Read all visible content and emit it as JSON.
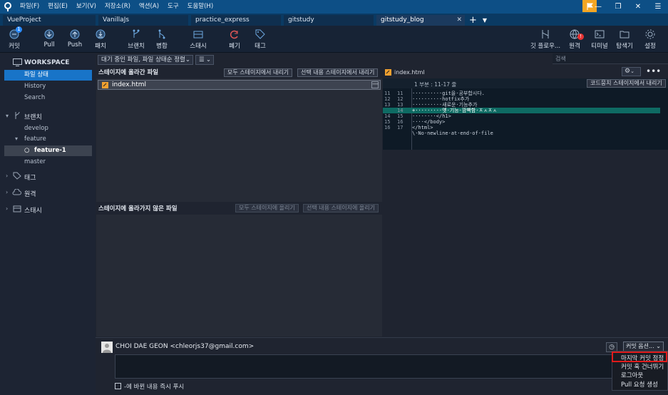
{
  "menu": [
    "파일(F)",
    "편집(E)",
    "보기(V)",
    "저장소(R)",
    "액션(A)",
    "도구",
    "도움말(H)"
  ],
  "tabs": [
    {
      "label": "VueProject",
      "active": false
    },
    {
      "label": "VanillaJs",
      "active": false
    },
    {
      "label": "practice_express",
      "active": false
    },
    {
      "label": "gitstudy",
      "active": false
    },
    {
      "label": "gitstudy_blog",
      "active": true
    }
  ],
  "toolbar": {
    "commit": "커밋",
    "commit_badge": "1",
    "pull": "Pull",
    "push": "Push",
    "fetch": "패치",
    "branch": "브랜치",
    "merge": "병합",
    "stash": "스태시",
    "discard": "폐기",
    "tag": "태그",
    "gitflow": "깃 플로우...",
    "remote": "원격",
    "remote_badge": "!",
    "terminal": "티미널",
    "explorer": "탐색기",
    "settings": "설정",
    "search_placeholder": "검색"
  },
  "sidebar": {
    "workspace": "WORKSPACE",
    "file_status": "파일 상태",
    "history": "History",
    "search": "Search",
    "branches": "브랜치",
    "branch_items": [
      "develop",
      "feature",
      "feature-1",
      "master"
    ],
    "tags": "태그",
    "remotes": "원격",
    "stashes": "스태시"
  },
  "filter": {
    "sort_label": "대기 중인 파일, 파일 상태순 정렬",
    "view_icon": "list-icon"
  },
  "staged": {
    "title": "스테이지에 올라간 파일",
    "unstage_all": "모두 스테이지에서 내리기",
    "unstage_selected": "선택 내용 스테이지에서 내리기",
    "files": [
      "index.html"
    ]
  },
  "unstaged": {
    "title": "스테이지에 올라가지 않은 파일",
    "stage_all": "모두 스테이지에 올리기",
    "stage_selected": "선택 내용 스테이지에 올리기"
  },
  "diff": {
    "file": "index.html",
    "hunk": "1 부분 : 11-17 줄",
    "unstage_hunk": "코드뭉치 스테이지에서 내리기",
    "lines": [
      {
        "o": "11",
        "n": "11",
        "text": "··········git을·공부합시다.",
        "added": false
      },
      {
        "o": "12",
        "n": "12",
        "text": "··········hotfix추가",
        "added": false
      },
      {
        "o": "13",
        "n": "13",
        "text": "··········새로운·기능추가",
        "added": false
      },
      {
        "o": "",
        "n": "14",
        "text": "+·········옛·기능·깜빡함·ㅈㅅㅈㅅ",
        "added": true
      },
      {
        "o": "14",
        "n": "15",
        "text": "········</h1>",
        "added": false
      },
      {
        "o": "15",
        "n": "16",
        "text": "····</body>",
        "added": false
      },
      {
        "o": "16",
        "n": "17",
        "text": "</html>",
        "added": false
      },
      {
        "o": "",
        "n": "",
        "text": "\\·No·newline·at·end·of·file",
        "added": false
      }
    ]
  },
  "commit": {
    "author": "CHOI DAE GEON <chleorjs37@gmail.com>",
    "options_label": "커밋 옵션...",
    "push_now": "-에 바뀐 내용 즉시 푸시",
    "menu": [
      "마지막 커밋 정정",
      "커밋 훅 건너뛰기",
      "로그아웃",
      "Pull 요청 생성"
    ]
  },
  "colors": {
    "accent": "#1874c8",
    "highlight_box": "#e01b1b",
    "added_line": "#0e6b63"
  }
}
